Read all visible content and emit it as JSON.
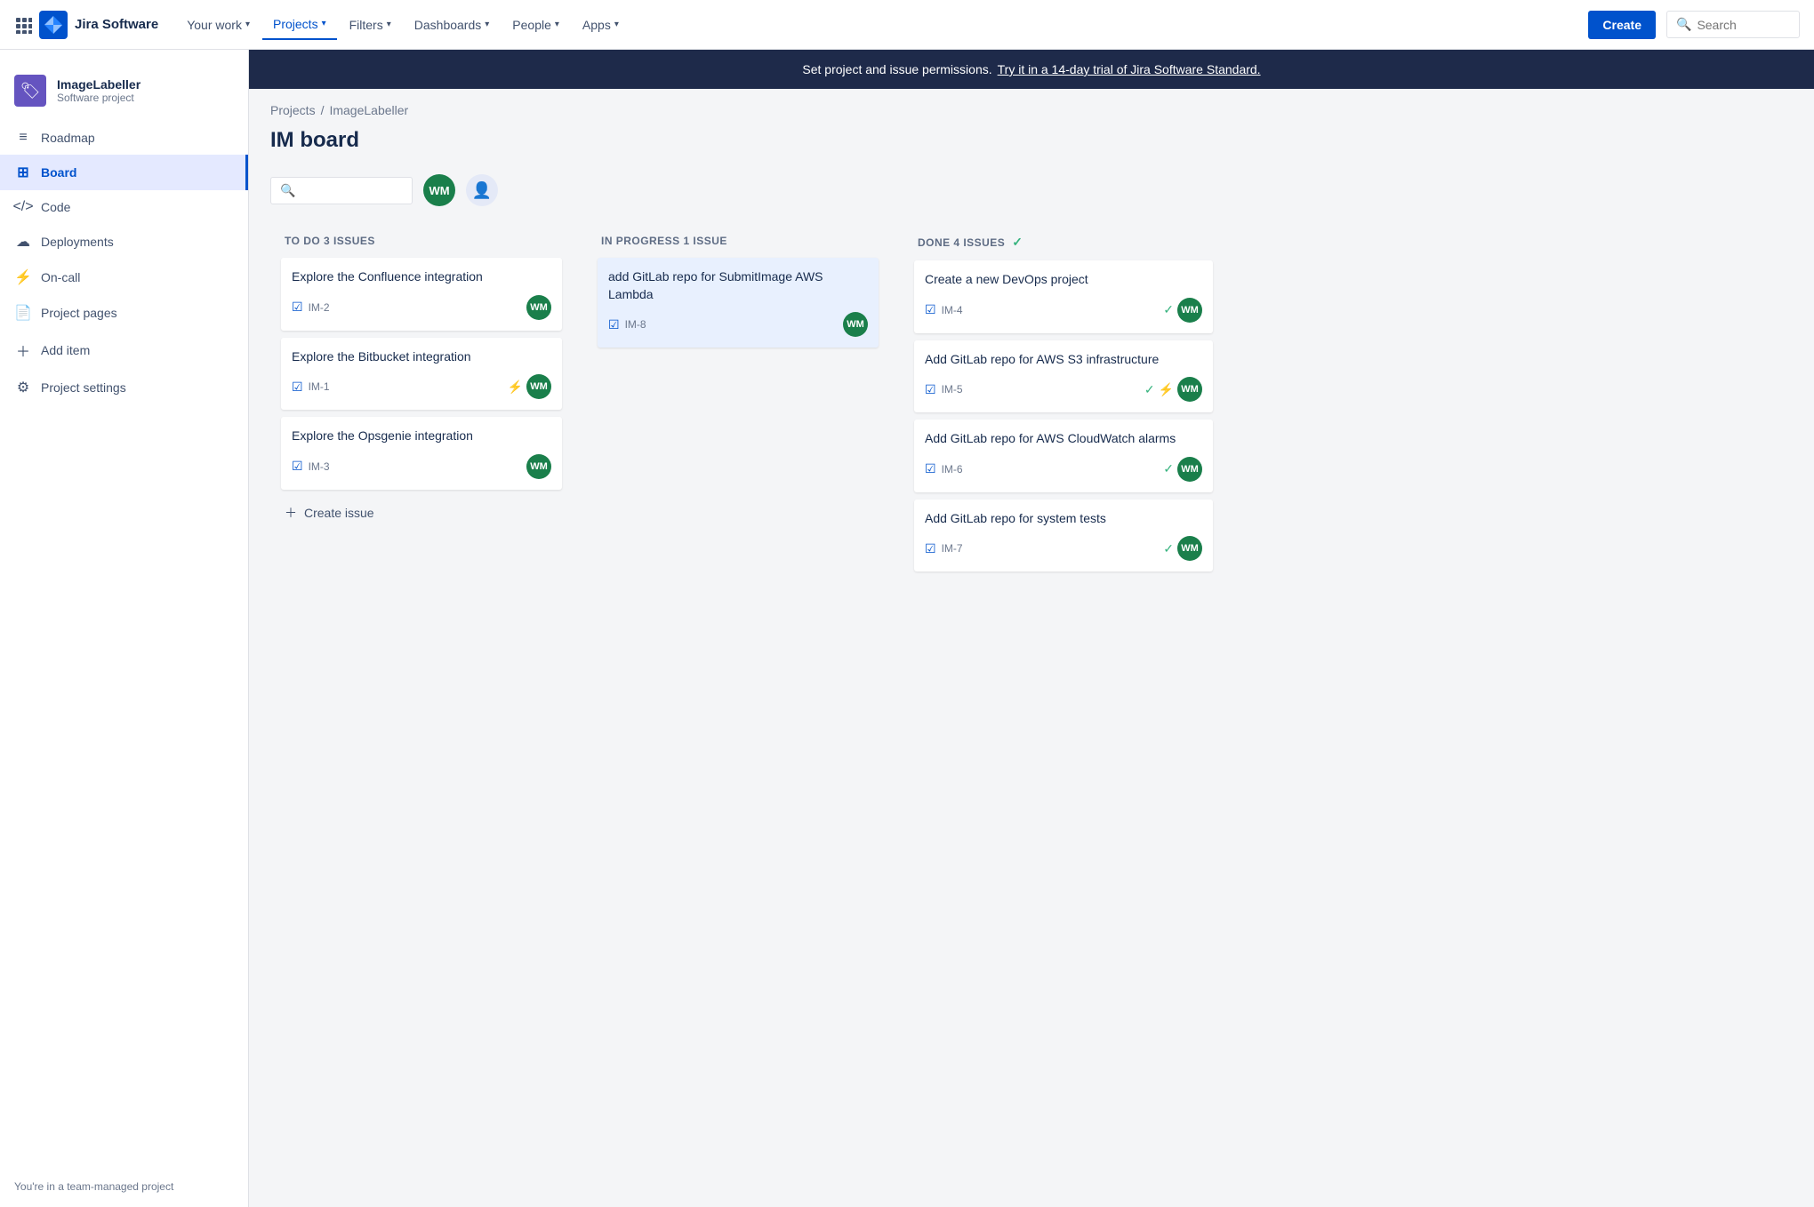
{
  "topnav": {
    "logo_text": "Jira Software",
    "nav_items": [
      {
        "label": "Your work",
        "has_arrow": true,
        "active": false
      },
      {
        "label": "Projects",
        "has_arrow": true,
        "active": true
      },
      {
        "label": "Filters",
        "has_arrow": true,
        "active": false
      },
      {
        "label": "Dashboards",
        "has_arrow": true,
        "active": false
      },
      {
        "label": "People",
        "has_arrow": true,
        "active": false
      },
      {
        "label": "Apps",
        "has_arrow": true,
        "active": false
      }
    ],
    "create_label": "Create",
    "search_placeholder": "Search"
  },
  "sidebar": {
    "project_name": "ImageLabeller",
    "project_type": "Software project",
    "items": [
      {
        "label": "Roadmap",
        "icon": "roadmap"
      },
      {
        "label": "Board",
        "icon": "board",
        "active": true
      },
      {
        "label": "Code",
        "icon": "code"
      },
      {
        "label": "Deployments",
        "icon": "deployments"
      },
      {
        "label": "On-call",
        "icon": "oncall"
      },
      {
        "label": "Project pages",
        "icon": "pages"
      },
      {
        "label": "Add item",
        "icon": "add"
      },
      {
        "label": "Project settings",
        "icon": "settings"
      }
    ],
    "footer_text": "You're in a team-managed project"
  },
  "banner": {
    "text": "Set project and issue permissions.",
    "link_text": "Try it in a 14-day trial of Jira Software Standard."
  },
  "breadcrumb": {
    "links": [
      "Projects",
      "ImageLabeller"
    ]
  },
  "page_title": "IM board",
  "board": {
    "columns": [
      {
        "id": "todo",
        "title": "TO DO",
        "issue_count": "3 ISSUES",
        "done_check": false,
        "cards": [
          {
            "id": "IM-2",
            "title": "Explore the Confluence integration",
            "highlight": false,
            "avatar": "WM",
            "extra_icon": null
          },
          {
            "id": "IM-1",
            "title": "Explore the Bitbucket integration",
            "highlight": false,
            "avatar": "WM",
            "extra_icon": "bolt"
          },
          {
            "id": "IM-3",
            "title": "Explore the Opsgenie integration",
            "highlight": false,
            "avatar": "WM",
            "extra_icon": null
          }
        ],
        "create_label": "Create issue"
      },
      {
        "id": "inprogress",
        "title": "IN PROGRESS",
        "issue_count": "1 ISSUE",
        "done_check": false,
        "cards": [
          {
            "id": "IM-8",
            "title": "add GitLab repo for SubmitImage AWS Lambda",
            "highlight": true,
            "avatar": "WM",
            "extra_icon": null
          }
        ],
        "create_label": null
      },
      {
        "id": "done",
        "title": "DONE",
        "issue_count": "4 ISSUES",
        "done_check": true,
        "cards": [
          {
            "id": "IM-4",
            "title": "Create a new DevOps project",
            "highlight": false,
            "avatar": "WM",
            "extra_icon": null,
            "done_icon": true
          },
          {
            "id": "IM-5",
            "title": "Add GitLab repo for AWS S3 infrastructure",
            "highlight": false,
            "avatar": "WM",
            "extra_icon": "bolt",
            "done_icon": true
          },
          {
            "id": "IM-6",
            "title": "Add GitLab repo for AWS CloudWatch alarms",
            "highlight": false,
            "avatar": "WM",
            "extra_icon": null,
            "done_icon": true
          },
          {
            "id": "IM-7",
            "title": "Add GitLab repo for system tests",
            "highlight": false,
            "avatar": "WM",
            "extra_icon": null,
            "done_icon": true
          }
        ],
        "create_label": null
      }
    ]
  }
}
